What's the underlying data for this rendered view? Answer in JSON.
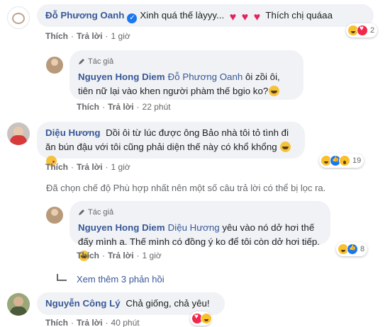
{
  "comments": [
    {
      "name": "Đỗ Phương Oanh",
      "verified": true,
      "text": "Xinh quá thế làyyy...",
      "text_after": "Thích chị quáaa",
      "like": "Thích",
      "reply": "Trả lời",
      "time": "1 giờ",
      "reaction_count": "2",
      "reactions": [
        "haha",
        "love"
      ]
    },
    {
      "badge": "Tác giả",
      "name": "Nguyen Hong Diem",
      "mention": "Đỗ Phương Oanh",
      "text": "ôi zồi ôi, tiên nữ lại vào khen người phàm thế bgio ko?",
      "like": "Thích",
      "reply": "Trả lời",
      "time": "22 phút"
    },
    {
      "name": "Diệu Hương",
      "text": "Dồi ôi từ lúc được ông Bảo nhà tôi tỏ tình đi ăn bún đậu với tôi cũng phải diện thế này có khổ khổng",
      "like": "Thích",
      "reply": "Trả lời",
      "time": "1 giờ",
      "reaction_count": "19",
      "reactions": [
        "haha",
        "like",
        "wow"
      ]
    },
    {
      "badge": "Tác giả",
      "name": "Nguyen Hong Diem",
      "mention": "Diệu Hương",
      "text": "yêu vào nó dở hơi thế đấy mình a. Thế mình có đồng ý ko để tôi còn dở hơi tiếp.",
      "like": "Thích",
      "reply": "Trả lời",
      "time": "1 giờ",
      "reaction_count": "8",
      "reactions": [
        "haha",
        "like"
      ]
    },
    {
      "name": "Nguyễn Công Lý",
      "text": "Chả giống, chả yêu!",
      "like": "Thích",
      "reply": "Trả lời",
      "time": "40 phút",
      "reactions": [
        "love",
        "haha"
      ]
    }
  ],
  "filter_notice": "Đã chọn chế độ Phù hợp nhất nên một số câu trả lời có thể bị lọc ra.",
  "see_more": "Xem thêm 3 phản hồi",
  "colors": {
    "link": "#385898",
    "bubble": "#f0f2f5",
    "meta": "#65676b"
  }
}
